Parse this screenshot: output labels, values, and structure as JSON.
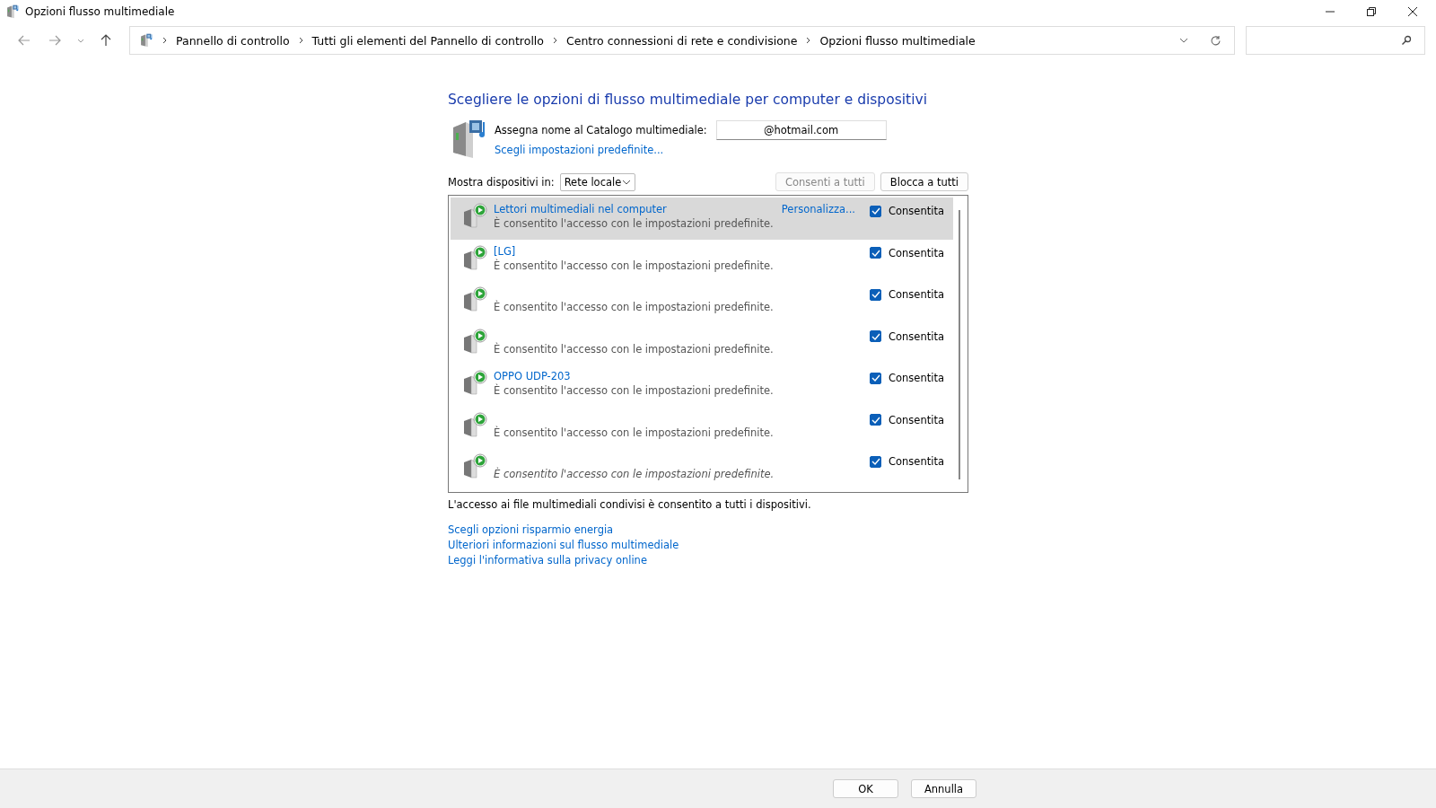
{
  "window": {
    "title": "Opzioni flusso multimediale"
  },
  "breadcrumb": [
    "Pannello di controllo",
    "Tutti gli elementi del Pannello di controllo",
    "Centro connessioni di rete e condivisione",
    "Opzioni flusso multimediale"
  ],
  "heading": "Scegliere le opzioni di flusso multimediale per computer e dispositivi",
  "library": {
    "label": "Assegna nome al Catalogo multimediale:",
    "value": "@hotmail.com",
    "defaults_link": "Scegli impostazioni predefinite..."
  },
  "filter": {
    "label": "Mostra dispositivi in:",
    "value": "Rete locale"
  },
  "buttons": [
    {
      "label": "Consenti a tutti",
      "disabled": true
    },
    {
      "label": "Blocca a tutti",
      "disabled": false
    }
  ],
  "devices": [
    {
      "name": "Lettori multimediali nel computer",
      "description": "È consentito l'accesso con le impostazioni predefinite.",
      "customize": "Personalizza...",
      "checkbox_label": "Consentita",
      "checked": true,
      "selected": true,
      "italic": false
    },
    {
      "name": "[LG]",
      "description": "È consentito l'accesso con le impostazioni predefinite.",
      "checkbox_label": "Consentita",
      "checked": true,
      "selected": false,
      "italic": false
    },
    {
      "description": "È consentito l'accesso con le impostazioni predefinite.",
      "checkbox_label": "Consentita",
      "checked": true,
      "selected": false,
      "italic": false
    },
    {
      "description": "È consentito l'accesso con le impostazioni predefinite.",
      "checkbox_label": "Consentita",
      "checked": true,
      "selected": false,
      "italic": false
    },
    {
      "name": "OPPO UDP-203",
      "description": "È consentito l'accesso con le impostazioni predefinite.",
      "checkbox_label": "Consentita",
      "checked": true,
      "selected": false,
      "italic": false
    },
    {
      "description": "È consentito l'accesso con le impostazioni predefinite.",
      "checkbox_label": "Consentita",
      "checked": true,
      "selected": false,
      "italic": false
    },
    {
      "description": "È consentito l'accesso con le impostazioni predefinite.",
      "checkbox_label": "Consentita",
      "checked": true,
      "selected": false,
      "italic": true
    }
  ],
  "status_text": "L'accesso ai file multimediali condivisi è consentito a tutti i dispositivi.",
  "links": [
    "Scegli opzioni risparmio energia",
    "Ulteriori informazioni sul flusso multimediale",
    "Leggi l'informativa sulla privacy online"
  ],
  "footer_buttons": [
    "OK",
    "Annulla"
  ]
}
